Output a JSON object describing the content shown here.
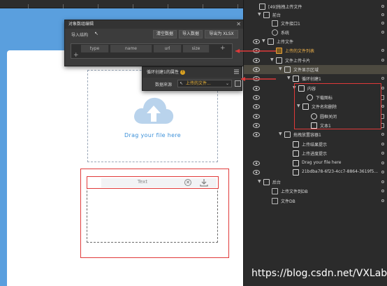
{
  "canvas": {
    "drag_text": "Drag your file here",
    "file_text": "Text"
  },
  "editor": {
    "title": "对象数组编辑",
    "import_label": "导入结构",
    "buttons": [
      "清空数据",
      "导入数据",
      "导出为 XLSX"
    ],
    "columns": [
      "type",
      "name",
      "url",
      "size"
    ]
  },
  "props": {
    "title": "循环创建1的属性",
    "source_label": "数据来源",
    "source_value": "上传的文件..."
  },
  "tree": {
    "rows": [
      {
        "label": "[49]拖拽上传文件",
        "eye": false,
        "arrow": "",
        "icon": "screen-icon"
      },
      {
        "label": "前台",
        "eye": false,
        "arrow": "▼",
        "icon": "phone-icon"
      },
      {
        "label": "文件接口1",
        "eye": false,
        "arrow": "",
        "icon": "doc-icon"
      },
      {
        "label": "系统",
        "eye": false,
        "arrow": "",
        "icon": "gear-icon"
      },
      {
        "label": "上传文件",
        "eye": true,
        "arrow": "▼",
        "icon": "phone-icon"
      },
      {
        "label": "上传的文件列表",
        "eye": true,
        "arrow": "",
        "icon": "list-icon"
      },
      {
        "label": "文件上传卡片",
        "eye": true,
        "arrow": "▼",
        "icon": "card-icon"
      },
      {
        "label": "文件显示区域",
        "eye": true,
        "arrow": "▼",
        "icon": "card-icon"
      },
      {
        "label": "循环创建1",
        "eye": true,
        "arrow": "▼",
        "icon": "loop-icon"
      },
      {
        "label": "内容",
        "eye": true,
        "arrow": "▼",
        "icon": "row-icon"
      },
      {
        "label": "下载图标",
        "eye": true,
        "arrow": "",
        "icon": "icon-icon"
      },
      {
        "label": "文件名和删除",
        "eye": true,
        "arrow": "▼",
        "icon": "row-icon"
      },
      {
        "label": "圆框关闭",
        "eye": true,
        "arrow": "",
        "icon": "icon-icon"
      },
      {
        "label": "文本1",
        "eye": true,
        "arrow": "",
        "icon": "text-icon"
      },
      {
        "label": "拖拽放置容器1",
        "eye": true,
        "arrow": "▼",
        "icon": "drop-icon"
      },
      {
        "label": "上传结果提示",
        "eye": false,
        "arrow": "",
        "icon": "text-icon"
      },
      {
        "label": "上传进度提示",
        "eye": false,
        "arrow": "",
        "icon": "text-icon"
      },
      {
        "label": "Drag your file here",
        "eye": true,
        "arrow": "",
        "icon": "text-icon"
      },
      {
        "label": "21bdba78-6f23-4cc7-8864-3619f5...",
        "eye": true,
        "arrow": "",
        "icon": "image-icon"
      },
      {
        "label": "后台",
        "eye": false,
        "arrow": "▼",
        "icon": "home-icon"
      },
      {
        "label": "上传文件到DB",
        "eye": false,
        "arrow": "",
        "icon": "doc-icon"
      },
      {
        "label": "文件DB",
        "eye": false,
        "arrow": "",
        "icon": "db-icon"
      }
    ]
  },
  "watermark": "https://blog.csdn.net/VXLab",
  "colors": {
    "canvas_bg": "#5a9fde",
    "accent_red": "#e03a3a",
    "source_value": "#e8b23a",
    "drag_text": "#3a8fd8"
  }
}
